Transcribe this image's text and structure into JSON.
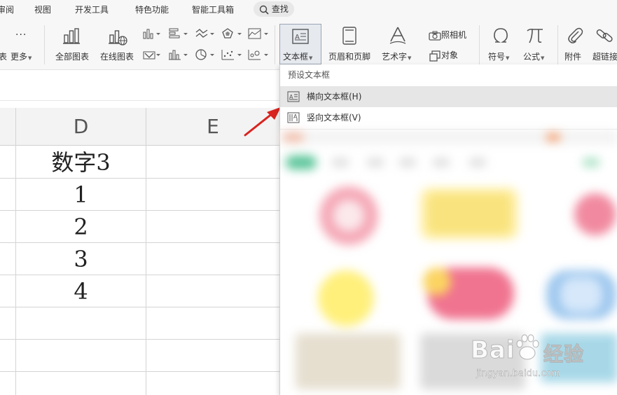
{
  "menu": {
    "tabs": [
      "审阅",
      "视图",
      "开发工具",
      "特色功能",
      "智能工具箱"
    ],
    "search": "查找"
  },
  "ribbon": {
    "partial_left": "表",
    "more": "更多",
    "all_charts": "全部图表",
    "online_charts": "在线图表",
    "textbox": "文本框",
    "header_footer": "页眉和页脚",
    "wordart": "艺术字",
    "camera": "照相机",
    "object": "对象",
    "symbol": "符号",
    "formula": "公式",
    "attachment": "附件",
    "hyperlink": "超链接"
  },
  "sheet": {
    "columns": [
      "D",
      "E"
    ],
    "rows": [
      "数字3",
      "1",
      "2",
      "3",
      "4"
    ]
  },
  "dropdown": {
    "header": "预设文本框",
    "items": [
      {
        "label": "横向文本框(H)"
      },
      {
        "label": "竖向文本框(V)"
      }
    ]
  },
  "watermark": {
    "brand": "Bai",
    "brand_suffix": "经验",
    "site": "jingyan.baidu.com"
  },
  "colors": {
    "accent_red": "#d9231f",
    "highlight": "#e6e6e6"
  }
}
